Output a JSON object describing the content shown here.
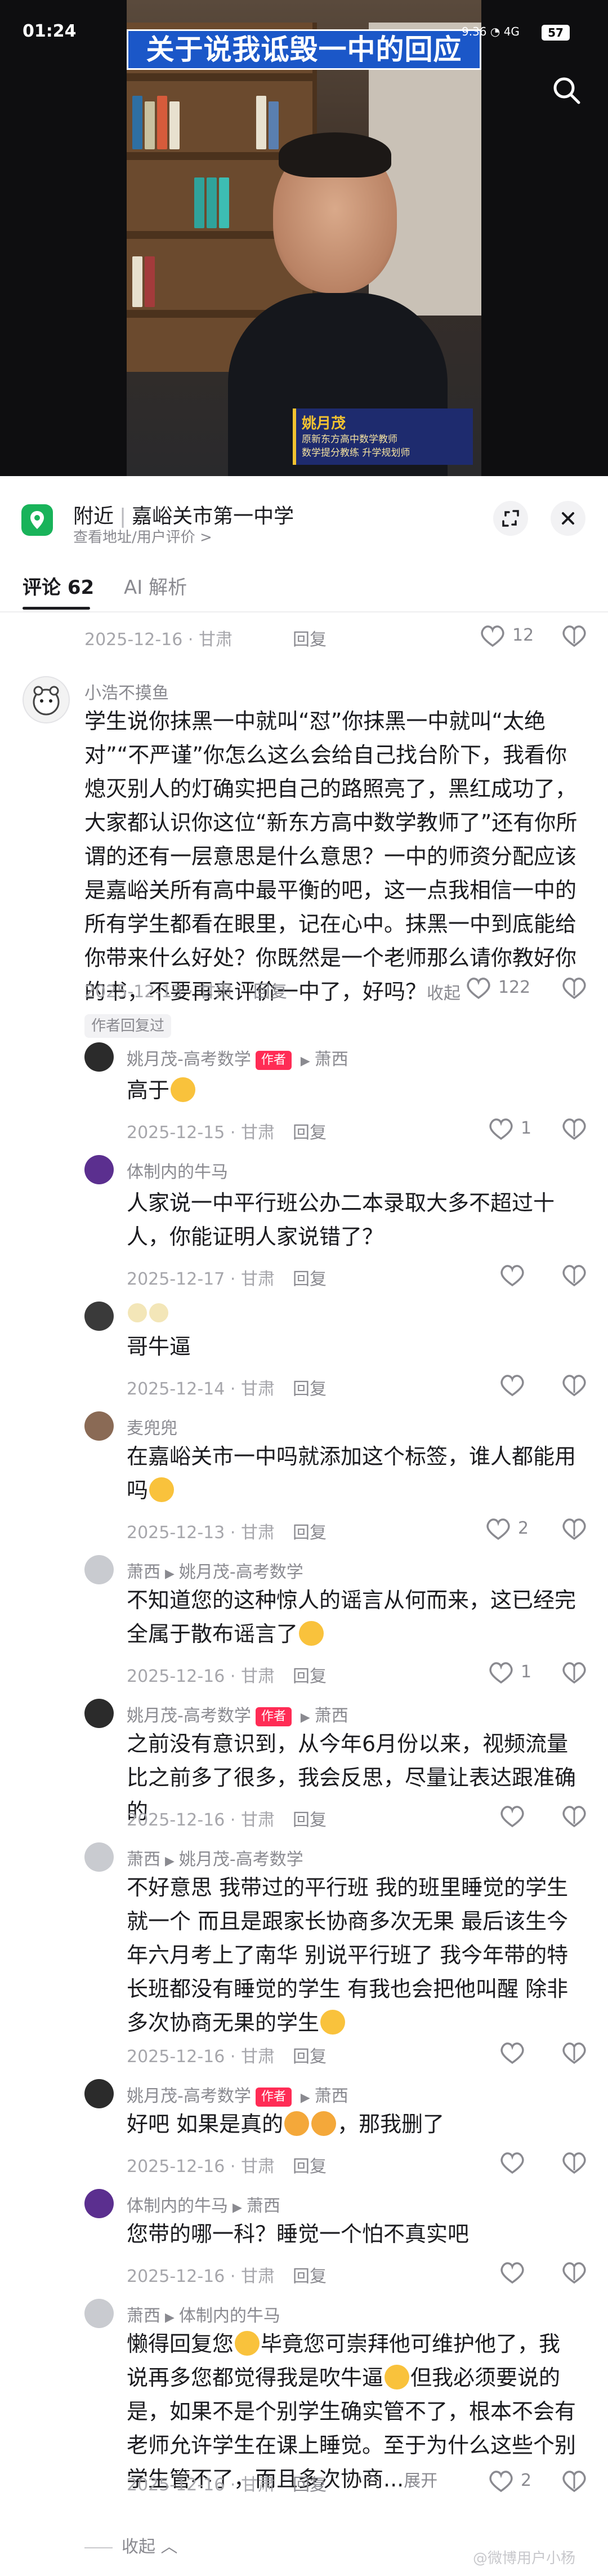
{
  "status_bar": {
    "time": "01:24",
    "network": "9.36",
    "signal": "4G",
    "battery": "57"
  },
  "video": {
    "title_overlay": "关于说我诋毁一中的回应",
    "name_card": {
      "name": "姚月茂",
      "line1": "原新东方高中数学教师",
      "line2": "数学提分教练 升学规划师"
    }
  },
  "location": {
    "prefix": "附近",
    "place": "嘉峪关市第一中学",
    "sub": "查看地址/用户评价 >"
  },
  "tabs": [
    {
      "label": "评论 62",
      "active": true
    },
    {
      "label": "AI 解析",
      "active": false
    }
  ],
  "comments": [
    {
      "id": "c0",
      "date": "2025-12-16",
      "loc": "甘肃",
      "reply": "回复",
      "likes": "12"
    },
    {
      "id": "c1",
      "author": "小浩不摸鱼",
      "text": "学生说你抹黑一中就叫“怼”你抹黑一中就叫“太绝对”“不严谨”你怎么这么会给自己找台阶下，我看你熄灭别人的灯确实把自己的路照亮了，黑红成功了，大家都认识你这位“新东方高中数学教师了”还有你所谓的还有一层意思是什么意思？一中的师资分配应该是嘉峪关所有高中最平衡的吧，这一点我相信一中的所有学生都看在眼里，记在心中。抹黑一中到底能给你带来什么好处？你既然是一个老师那么请你教好你的书，不要再来评价一中了，好吗？",
      "collapse": "收起",
      "date": "2025-12-13",
      "loc": "甘肃",
      "reply": "回复",
      "likes": "122",
      "badge": "作者回复过"
    },
    {
      "id": "r1",
      "author": "姚月茂-高考数学",
      "badge": "作者",
      "to": "萧西",
      "text": "高于",
      "date": "2025-12-15",
      "loc": "甘肃",
      "reply": "回复",
      "likes": "1"
    },
    {
      "id": "r2",
      "author": "体制内的牛马",
      "text": "人家说一中平行班公办二本录取大多不超过十人，你能证明人家说错了？",
      "date": "2025-12-17",
      "loc": "甘肃",
      "reply": "回复",
      "likes": ""
    },
    {
      "id": "r3",
      "author": "",
      "text": "哥牛逼",
      "date": "2025-12-14",
      "loc": "甘肃",
      "reply": "回复",
      "likes": ""
    },
    {
      "id": "r4",
      "author": "麦兜兜",
      "text": "在嘉峪关市一中吗就添加这个标签，谁人都能用吗",
      "date": "2025-12-13",
      "loc": "甘肃",
      "reply": "回复",
      "likes": "2"
    },
    {
      "id": "r5",
      "author": "萧西",
      "to": "姚月茂-高考数学",
      "text": "不知道您的这种惊人的谣言从何而来，这已经完全属于散布谣言了",
      "date": "2025-12-16",
      "loc": "甘肃",
      "reply": "回复",
      "likes": "1"
    },
    {
      "id": "r6",
      "author": "姚月茂-高考数学",
      "badge": "作者",
      "to": "萧西",
      "text": "之前没有意识到，从今年6月份以来，视频流量比之前多了很多，我会反思，尽量让表达跟准确的",
      "date": "2025-12-16",
      "loc": "甘肃",
      "reply": "回复",
      "likes": ""
    },
    {
      "id": "r7",
      "author": "萧西",
      "to": "姚月茂-高考数学",
      "text": "不好意思 我带过的平行班 我的班里睡觉的学生就一个 而且是跟家长协商多次无果 最后该生今年六月考上了南华 别说平行班了 我今年带的特长班都没有睡觉的学生 有我也会把他叫醒 除非多次协商无果的学生",
      "date": "2025-12-16",
      "loc": "甘肃",
      "reply": "回复",
      "likes": ""
    },
    {
      "id": "r8",
      "author": "姚月茂-高考数学",
      "badge": "作者",
      "to": "萧西",
      "text": "好吧 如果是真的",
      "text2": "，那我删了",
      "date": "2025-12-16",
      "loc": "甘肃",
      "reply": "回复",
      "likes": ""
    },
    {
      "id": "r9",
      "author": "体制内的牛马",
      "to": "萧西",
      "text": "您带的哪一科？睡觉一个怕不真实吧",
      "date": "2025-12-16",
      "loc": "甘肃",
      "reply": "回复",
      "likes": ""
    },
    {
      "id": "r10",
      "author": "萧西",
      "to": "体制内的牛马",
      "text": "懒得回复您",
      "text2": "毕竟您可崇拜他可维护他了，我说再多您都觉得我是吹牛逼",
      "text3": "但我必须要说的是，如果不是个别学生确实管不了，根本不会有老师允许学生在课上睡觉。至于为什么这些个别学生管不了，而且多次协商...",
      "expand": "展开",
      "date": "2025-12-16",
      "loc": "甘肃",
      "reply": "回复",
      "likes": "2"
    }
  ],
  "collapse_all": "收起",
  "watermark": "@微博用户小杨"
}
